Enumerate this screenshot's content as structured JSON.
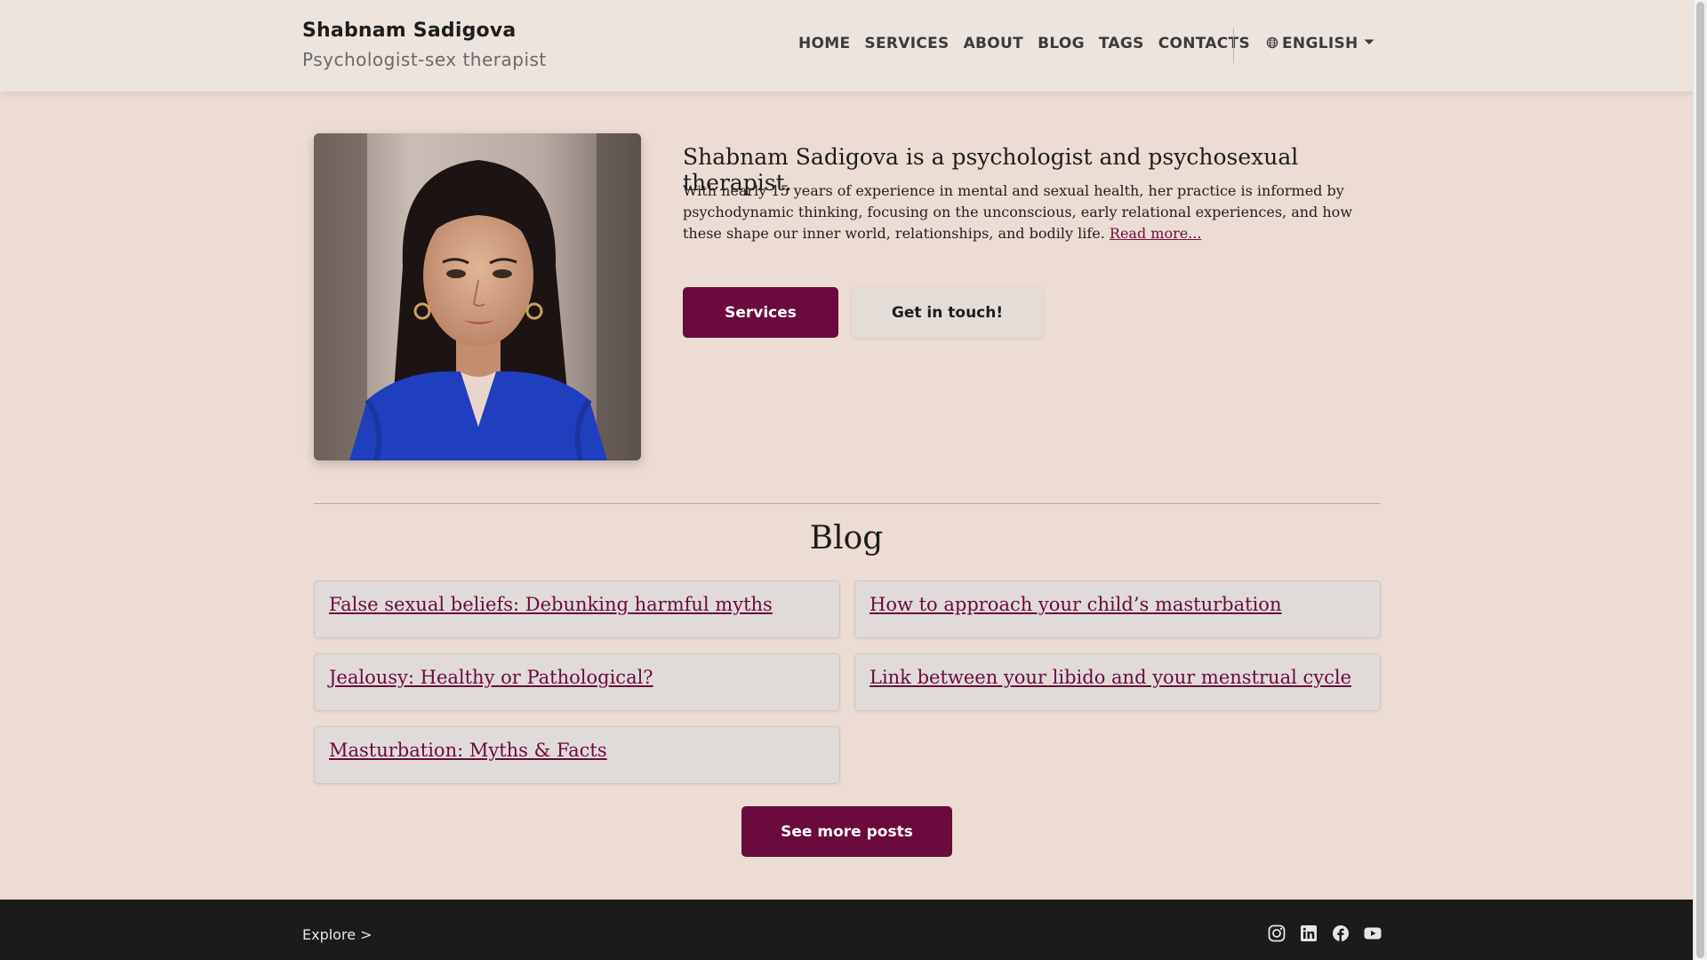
{
  "header": {
    "brand_name": "Shabnam Sadigova",
    "brand_subtitle": "Psychologist-sex therapist",
    "nav": [
      "HOME",
      "SERVICES",
      "ABOUT",
      "BLOG",
      "TAGS",
      "CONTACTS"
    ],
    "language": "ENGLISH"
  },
  "hero": {
    "portrait_icon": "portrait-photo",
    "title": "Shabnam Sadigova is a psychologist and psychosexual therapist.",
    "body": "With nearly 15 years of experience in mental and sexual health, her practice is informed by psychodynamic thinking, focusing on the unconscious, early relational experiences, and how these shape our inner world, relationships, and bodily life.",
    "read_more": "Read more...",
    "services_button": "Services",
    "contact_button": "Get in touch!"
  },
  "blog": {
    "heading": "Blog",
    "posts": [
      "False sexual beliefs: Debunking harmful myths",
      "How to approach your child’s masturbation",
      "Jealousy: Healthy or Pathological?",
      "Link between your libido and your menstrual cycle",
      "Masturbation: Myths & Facts"
    ],
    "more_button": "See more posts"
  },
  "footer": {
    "explore": "Explore >",
    "socials": [
      "instagram-icon",
      "linkedin-icon",
      "facebook-icon",
      "youtube-icon"
    ]
  },
  "colors": {
    "brand": "#6b0a3c",
    "background": "#eddcd3",
    "header_bg": "#ede4de",
    "footer_bg": "#1b1b1b"
  }
}
